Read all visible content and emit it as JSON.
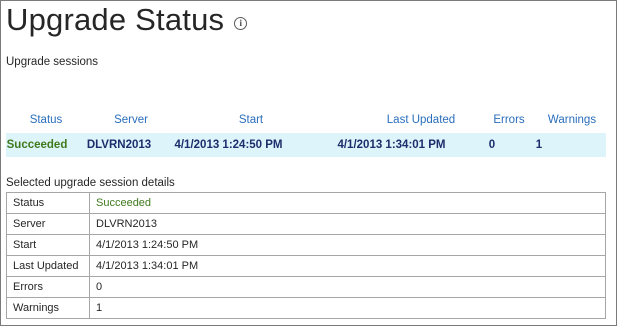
{
  "page": {
    "title": "Upgrade Status",
    "info_icon": "i"
  },
  "sessions": {
    "label": "Upgrade sessions",
    "columns": [
      "Status",
      "Server",
      "Start",
      "Last Updated",
      "Errors",
      "Warnings"
    ],
    "rows": [
      {
        "status": "Succeeded",
        "server": "DLVRN2013",
        "start": "4/1/2013 1:24:50 PM",
        "last_updated": "4/1/2013 1:34:01 PM",
        "errors": "0",
        "warnings": "1"
      }
    ]
  },
  "details": {
    "label": "Selected upgrade session details",
    "rows": [
      {
        "key": "Status",
        "value": "Succeeded"
      },
      {
        "key": "Server",
        "value": "DLVRN2013"
      },
      {
        "key": "Start",
        "value": "4/1/2013 1:24:50 PM"
      },
      {
        "key": "Last Updated",
        "value": "4/1/2013 1:34:01 PM"
      },
      {
        "key": "Errors",
        "value": "0"
      },
      {
        "key": "Warnings",
        "value": "1"
      }
    ]
  },
  "colors": {
    "header_link": "#2a6ebb",
    "success": "#3f7a1d",
    "selected_row_bg": "#ddf4fb",
    "row_text": "#1c2e6b"
  }
}
